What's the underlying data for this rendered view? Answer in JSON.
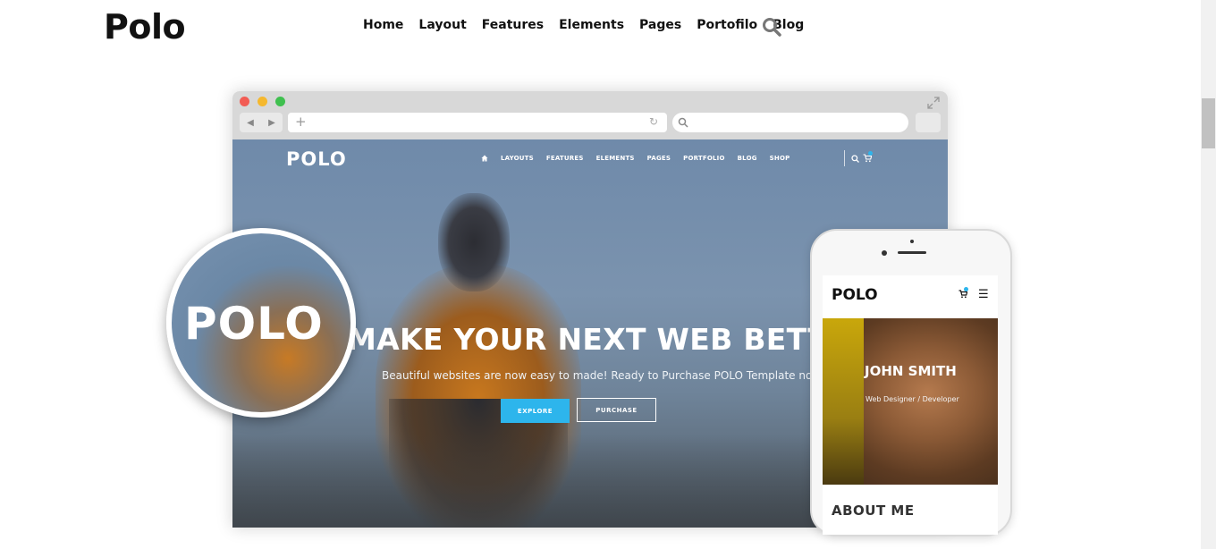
{
  "header": {
    "logo": "Polo",
    "nav": [
      "Home",
      "Layout",
      "Features",
      "Elements",
      "Pages",
      "Portofilo",
      "Blog"
    ]
  },
  "browser_mockup": {
    "site_logo": "POLO",
    "site_nav": [
      "LAYOUTS",
      "FEATURES",
      "ELEMENTS",
      "PAGES",
      "PORTFOLIO",
      "BLOG",
      "SHOP"
    ],
    "hero_title": "MAKE YOUR NEXT WEB BETTER",
    "hero_subtitle": "Beautiful websites are now easy to made! Ready to Purchase POLO Template now?",
    "btn_explore": "EXPLORE",
    "btn_purchase": "PURCHASE",
    "accent_color": "#2db5ec"
  },
  "magnifier": {
    "text": "POLO"
  },
  "phone_mockup": {
    "logo": "POLO",
    "name": "JOHN SMITH",
    "role": "Web Designer / Developer",
    "section_title": "ABOUT ME"
  },
  "icons": [
    "search-icon",
    "home-icon",
    "cart-icon",
    "menu-icon"
  ]
}
